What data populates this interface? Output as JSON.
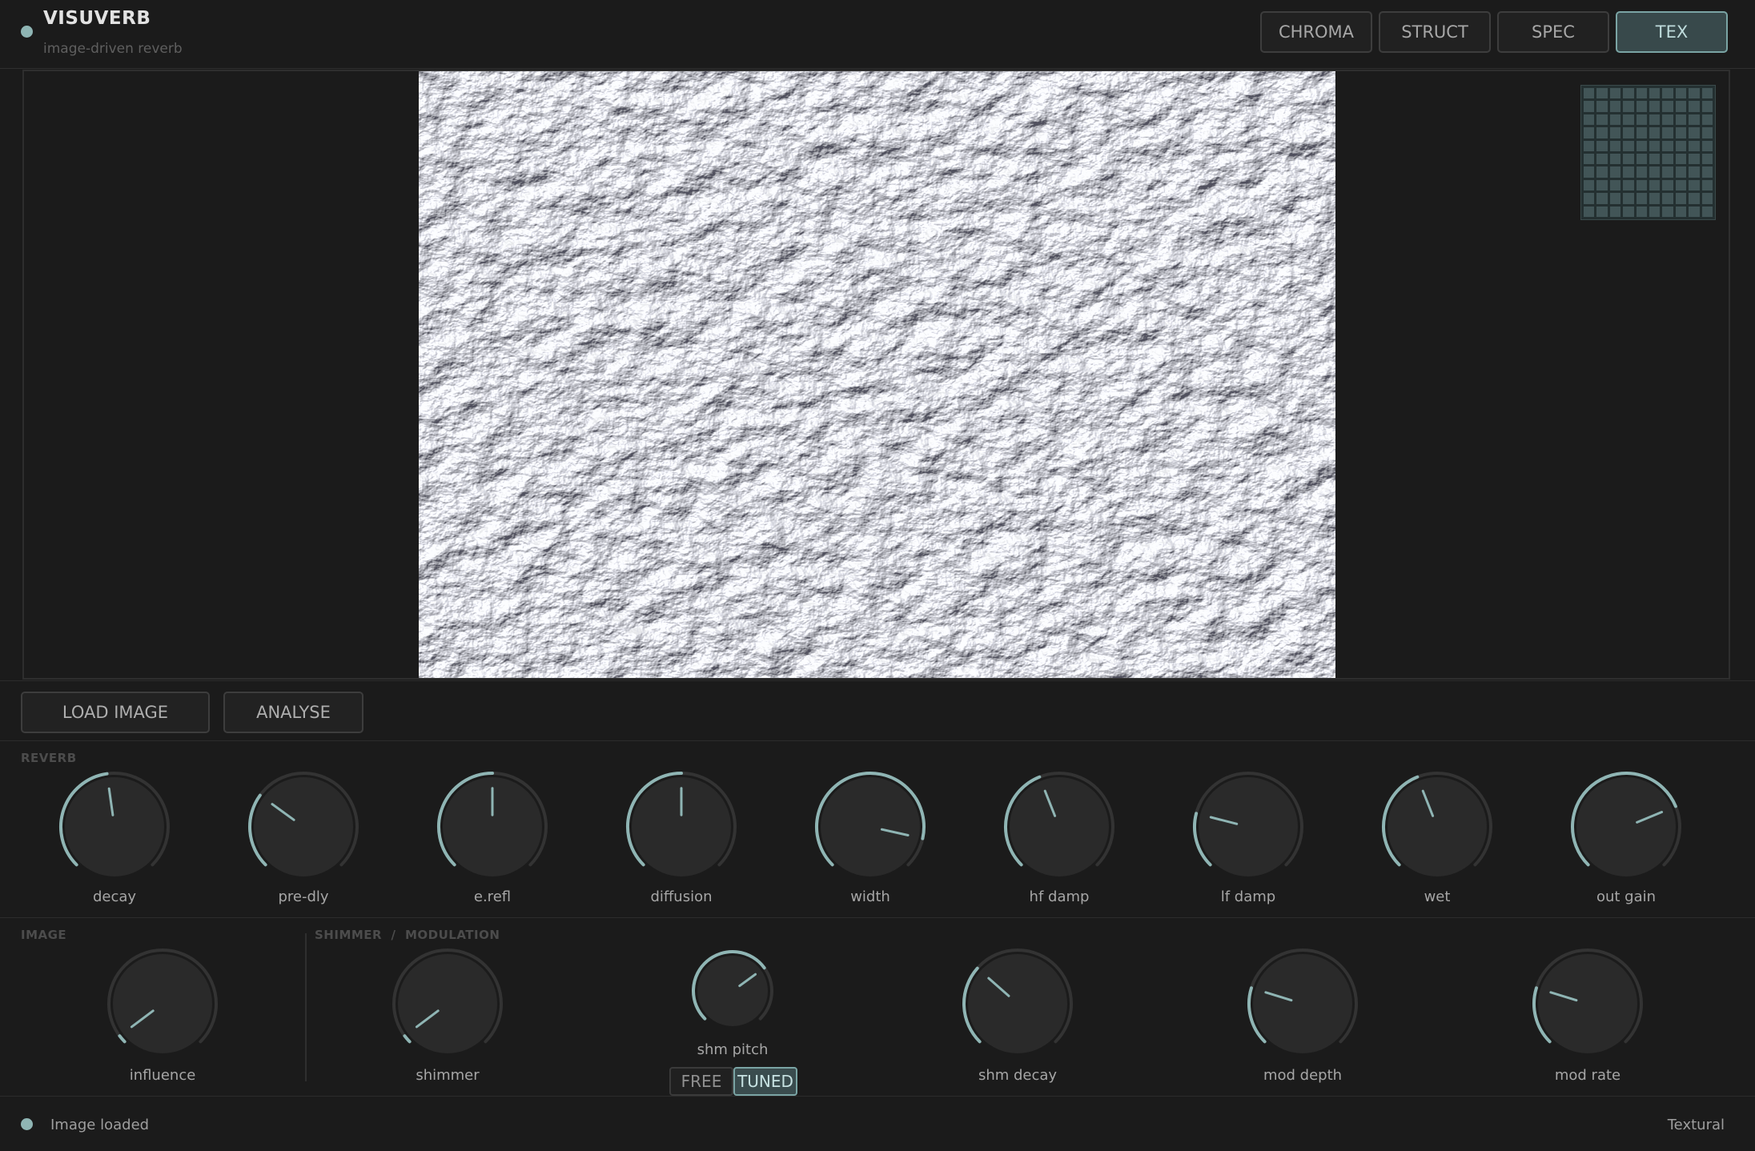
{
  "header": {
    "title": "VISUVERB",
    "subtitle": "image-driven reverb",
    "tabs": [
      {
        "label": "CHROMA",
        "active": false
      },
      {
        "label": "STRUCT",
        "active": false
      },
      {
        "label": "SPEC",
        "active": false
      },
      {
        "label": "TEX",
        "active": true
      }
    ]
  },
  "actions": {
    "load_label": "LOAD IMAGE",
    "analyse_label": "ANALYSE"
  },
  "reverb": {
    "section_label": "REVERB",
    "knobs": [
      {
        "label": "decay",
        "value": 0.47
      },
      {
        "label": "pre-dly",
        "value": 0.3
      },
      {
        "label": "e.refl",
        "value": 0.5
      },
      {
        "label": "diffusion",
        "value": 0.5
      },
      {
        "label": "width",
        "value": 0.88
      },
      {
        "label": "hf damp",
        "value": 0.42
      },
      {
        "label": "lf damp",
        "value": 0.22
      },
      {
        "label": "wet",
        "value": 0.42
      },
      {
        "label": "out gain",
        "value": 0.75
      }
    ]
  },
  "image_section": {
    "section_label": "IMAGE",
    "knobs": [
      {
        "label": "influence",
        "value": 0.03
      }
    ]
  },
  "shimmer_section": {
    "section_label": "SHIMMER  /  MODULATION",
    "knobs": [
      {
        "label": "shimmer",
        "value": 0.03
      },
      {
        "label": "shm pitch",
        "value": 0.7
      },
      {
        "label": "shm decay",
        "value": 0.32
      },
      {
        "label": "mod depth",
        "value": 0.23
      },
      {
        "label": "mod rate",
        "value": 0.23
      }
    ],
    "pitch_mode": {
      "free_label": "FREE",
      "tuned_label": "TUNED",
      "selected": "TUNED"
    }
  },
  "statusbar": {
    "status_text": "Image loaded",
    "mode_text": "Textural"
  },
  "colors": {
    "accent": "#8fb5b4",
    "accent_active_bg": "#38494b",
    "knob_body": "#2a2a2a",
    "track": "#333333"
  }
}
